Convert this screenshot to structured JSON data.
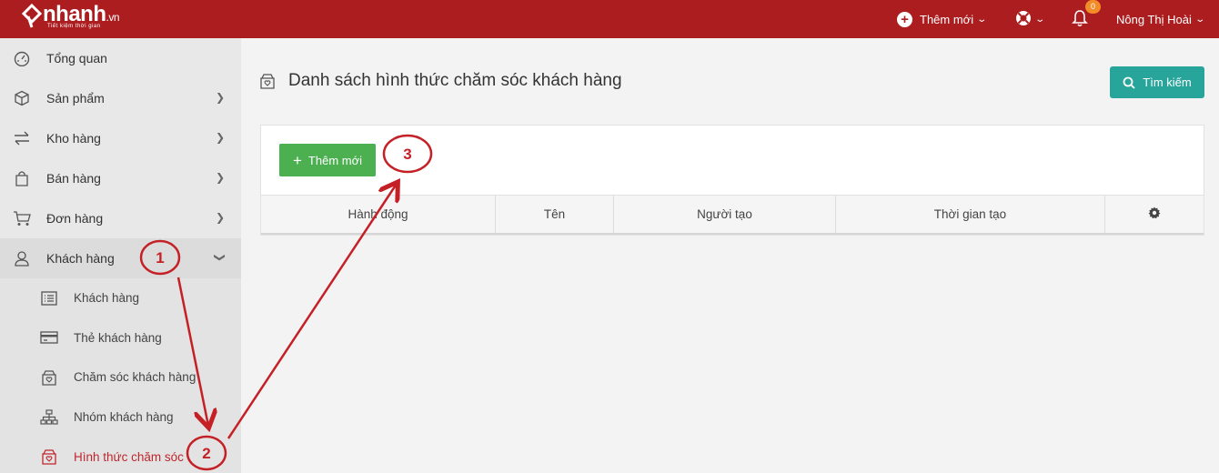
{
  "topbar": {
    "logo_text": "nhanh",
    "logo_suffix": ".vn",
    "logo_tagline": "Tiết kiệm thời gian",
    "add_new_label": "Thêm mới",
    "notification_count": "0",
    "user_name": "Nông Thị Hoài",
    "bg_color": "#ac1d20"
  },
  "sidebar": {
    "items": [
      {
        "label": "Tổng quan",
        "icon": "dashboard-icon"
      },
      {
        "label": "Sản phẩm",
        "icon": "box-icon"
      },
      {
        "label": "Kho hàng",
        "icon": "transfer-icon"
      },
      {
        "label": "Bán hàng",
        "icon": "shopping-bag-icon"
      },
      {
        "label": "Đơn hàng",
        "icon": "cart-icon"
      },
      {
        "label": "Khách hàng",
        "icon": "user-icon"
      }
    ],
    "sub_items": [
      {
        "label": "Khách hàng",
        "icon": "list-icon"
      },
      {
        "label": "Thẻ khách hàng",
        "icon": "card-icon"
      },
      {
        "label": "Chăm sóc khách hàng",
        "icon": "care-box-icon"
      },
      {
        "label": "Nhóm khách hàng",
        "icon": "sitemap-icon"
      },
      {
        "label": "Hình thức chăm sóc",
        "icon": "care-box-icon"
      }
    ]
  },
  "main": {
    "title": "Danh sách hình thức chăm sóc khách hàng",
    "search_label": "Tìm kiếm",
    "add_label": "Thêm mới",
    "columns": [
      "Hành động",
      "Tên",
      "Người tạo",
      "Thời gian tạo"
    ]
  },
  "annotations": {
    "labels": [
      "1",
      "2",
      "3"
    ],
    "color": "#c42025"
  },
  "colors": {
    "accent": "#ac1d20",
    "search_button": "#27a59a",
    "add_button": "#4caf50",
    "badge": "#f28c28"
  }
}
